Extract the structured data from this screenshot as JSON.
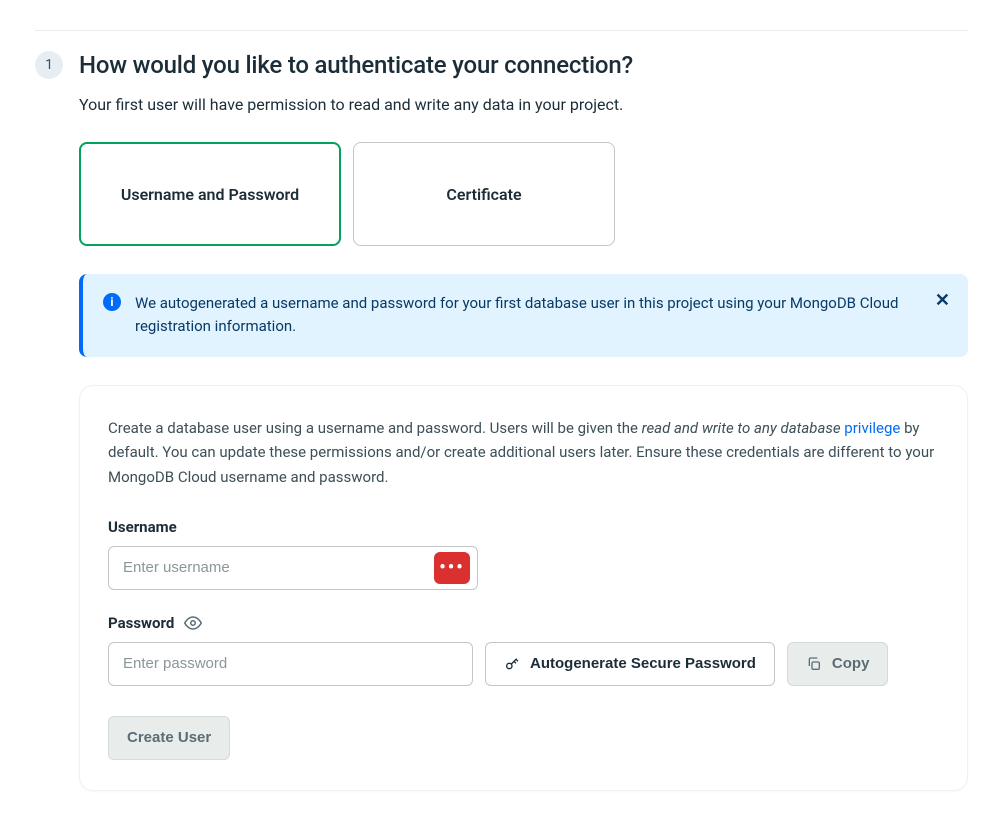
{
  "step": {
    "number": "1",
    "title": "How would you like to authenticate your connection?"
  },
  "subtitle": "Your first user will have permission to read and write any data in your project.",
  "authOptions": {
    "usernamePassword": "Username and Password",
    "certificate": "Certificate"
  },
  "infoBanner": {
    "text": "We autogenerated a username and password for your first database user in this project using your MongoDB Cloud registration information."
  },
  "form": {
    "desc_part1": "Create a database user using a username and password. Users will be given the ",
    "desc_em": "read and write to any database ",
    "desc_link": "privilege",
    "desc_part2": " by default. You can update these permissions and/or create additional users later. Ensure these credentials are different to your MongoDB Cloud username and password.",
    "usernameLabel": "Username",
    "usernamePlaceholder": "Enter username",
    "passwordLabel": "Password",
    "passwordPlaceholder": "Enter password",
    "autogenLabel": "Autogenerate Secure Password",
    "copyLabel": "Copy",
    "createLabel": "Create User"
  }
}
